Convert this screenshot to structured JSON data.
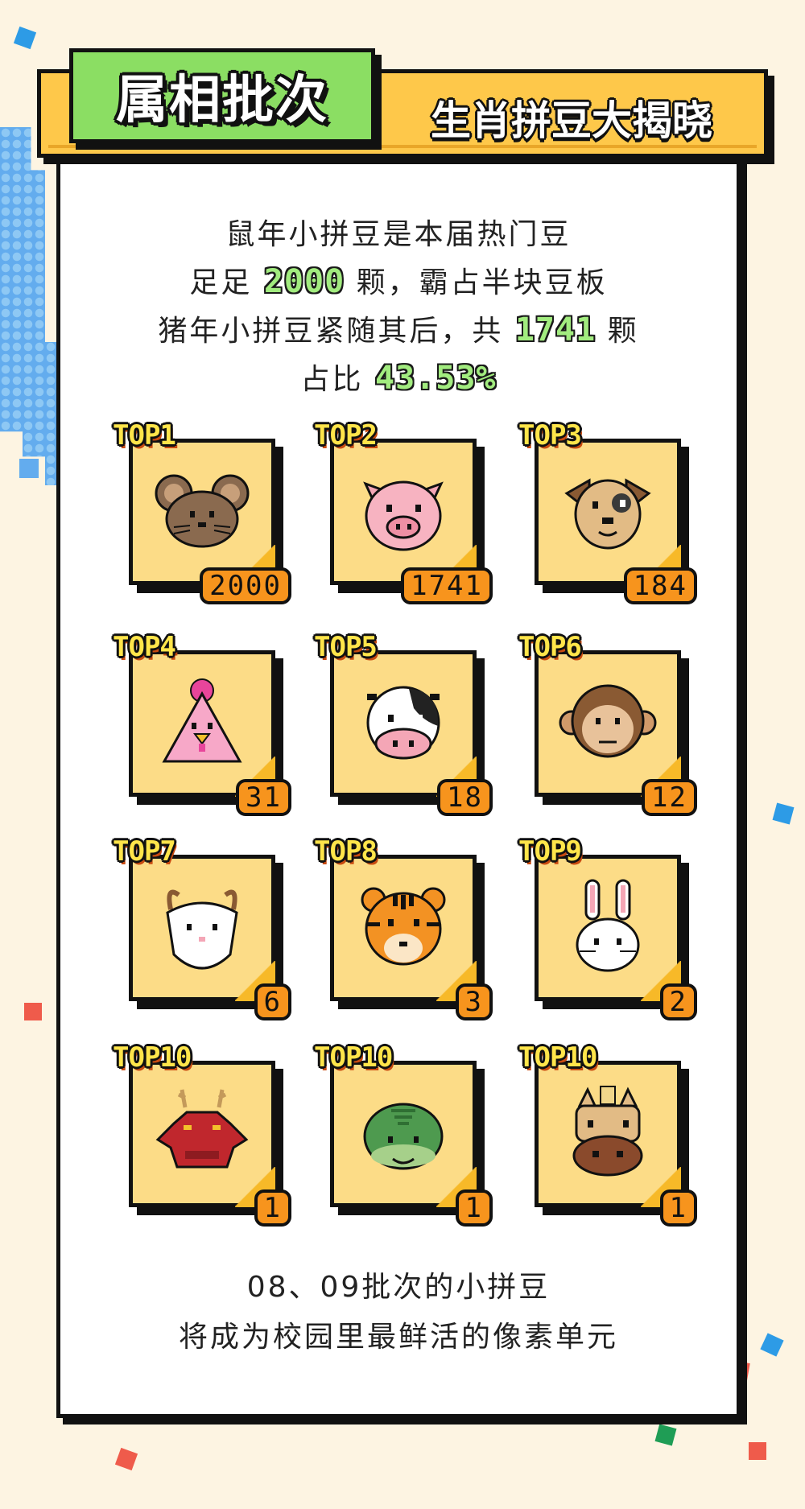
{
  "header": {
    "tag": "属相批次",
    "title": "生肖拼豆大揭晓"
  },
  "intro": {
    "line1": "鼠年小拼豆是本届热门豆",
    "line2_pre": "足足",
    "line2_num": "2000",
    "line2_post": "颗，霸占半块豆板",
    "line3_pre": "猪年小拼豆紧随其后，共",
    "line3_num": "1741",
    "line3_post": "颗",
    "line4_pre": "占比",
    "line4_num": "43.53%"
  },
  "tiles": [
    {
      "rank": "TOP1",
      "count": "2000",
      "animal": "rat",
      "icon": "rat-icon"
    },
    {
      "rank": "TOP2",
      "count": "1741",
      "animal": "pig",
      "icon": "pig-icon"
    },
    {
      "rank": "TOP3",
      "count": "184",
      "animal": "dog",
      "icon": "dog-icon"
    },
    {
      "rank": "TOP4",
      "count": "31",
      "animal": "rooster",
      "icon": "rooster-icon"
    },
    {
      "rank": "TOP5",
      "count": "18",
      "animal": "ox",
      "icon": "ox-icon"
    },
    {
      "rank": "TOP6",
      "count": "12",
      "animal": "monkey",
      "icon": "monkey-icon"
    },
    {
      "rank": "TOP7",
      "count": "6",
      "animal": "goat",
      "icon": "goat-icon"
    },
    {
      "rank": "TOP8",
      "count": "3",
      "animal": "tiger",
      "icon": "tiger-icon"
    },
    {
      "rank": "TOP9",
      "count": "2",
      "animal": "rabbit",
      "icon": "rabbit-icon"
    },
    {
      "rank": "TOP10",
      "count": "1",
      "animal": "dragon",
      "icon": "dragon-icon"
    },
    {
      "rank": "TOP10",
      "count": "1",
      "animal": "snake",
      "icon": "snake-icon"
    },
    {
      "rank": "TOP10",
      "count": "1",
      "animal": "horse",
      "icon": "horse-icon"
    }
  ],
  "outro": {
    "line1": "08、09批次的小拼豆",
    "line2": "将成为校园里最鲜活的像素单元"
  },
  "colors": {
    "background": "#fdf4e2",
    "header_yellow": "#fec84a",
    "tag_green": "#8bde63",
    "tile_fill": "#fcdc87",
    "badge_orange": "#f7941d"
  }
}
